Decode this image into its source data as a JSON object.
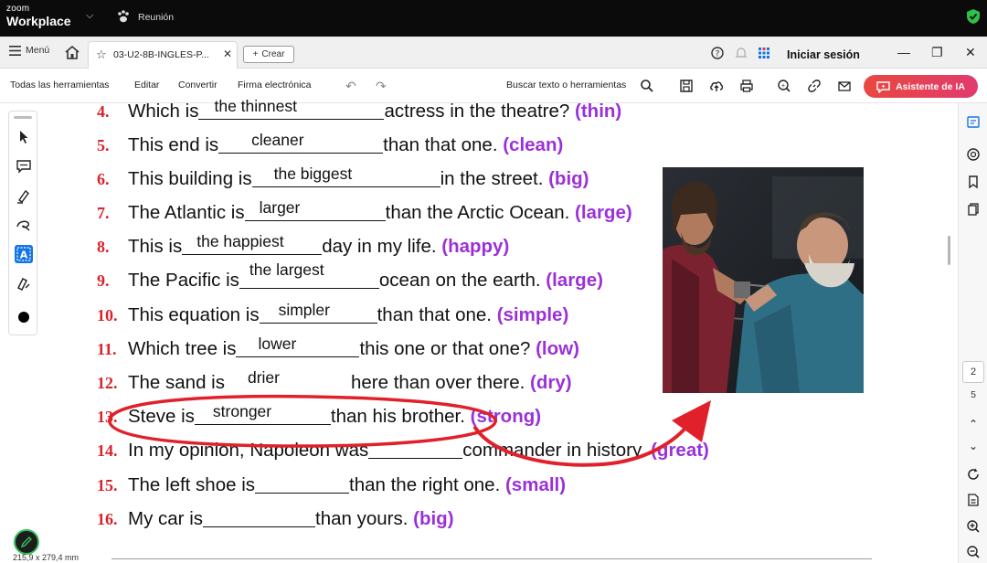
{
  "zoom": {
    "brand_line1": "zoom",
    "brand_line2": "Workplace",
    "meeting_label": "Reunión"
  },
  "tabs": {
    "menu_label": "Menú",
    "doc_tab_label": "03-U2-8B-INGLES-P...",
    "create_label": "Crear",
    "login_label": "Iniciar sesión"
  },
  "tools": {
    "all_tools": "Todas las herramientas",
    "edit": "Editar",
    "convert": "Convertir",
    "sign": "Firma electrónica",
    "search": "Buscar texto o herramientas",
    "ai_assistant": "Asistente de IA"
  },
  "exercises": [
    {
      "num": "4.",
      "before": "Which is",
      "answer": "the thinnest",
      "after": "actress in the theatre?",
      "hint": "(thin)"
    },
    {
      "num": "5.",
      "before": "This end is",
      "answer": "cleaner",
      "after": "than that one.",
      "hint": "(clean)"
    },
    {
      "num": "6.",
      "before": "This building is",
      "answer": "the biggest",
      "after": "in the street.",
      "hint": "(big)"
    },
    {
      "num": "7.",
      "before": "The Atlantic is",
      "answer": "larger",
      "after": "than the Arctic Ocean.",
      "hint": "(large)"
    },
    {
      "num": "8.",
      "before": "This is",
      "answer": "the happiest",
      "after": "day in my life.",
      "hint": "(happy)"
    },
    {
      "num": "9.",
      "before": "The Pacific is",
      "answer": "the largest",
      "after": "ocean on the earth.",
      "hint": "(large)"
    },
    {
      "num": "10.",
      "before": "This equation is",
      "answer": "simpler",
      "after": "than that one.",
      "hint": "(simple)"
    },
    {
      "num": "11.",
      "before": "Which tree is",
      "answer": "lower",
      "after": "this one or that one?",
      "hint": "(low)"
    },
    {
      "num": "12.",
      "before": "The sand is",
      "answer": "drier",
      "after": "here than over there.",
      "hint": "(dry)"
    },
    {
      "num": "13.",
      "before": "Steve is",
      "answer": "stronger",
      "after": "than his brother.",
      "hint": "(strong)"
    },
    {
      "num": "14.",
      "before": "In my opinion, Napoleon was",
      "answer": "",
      "after": "commander in history.",
      "hint": "(great)"
    },
    {
      "num": "15.",
      "before": "The left shoe is",
      "answer": "",
      "after": "than the right one.",
      "hint": "(small)"
    },
    {
      "num": "16.",
      "before": "My car is",
      "answer": "",
      "after": "than yours.",
      "hint": "(big)"
    }
  ],
  "pagination": {
    "current_page": "2",
    "total_pages": "5"
  },
  "status": {
    "page_size": "215,9 x 279,4 mm"
  },
  "colors": {
    "exercise_number": "#d9232b",
    "hint": "#9b30d9",
    "annotation": "#e0202a",
    "ai_button": "#e8483f"
  }
}
